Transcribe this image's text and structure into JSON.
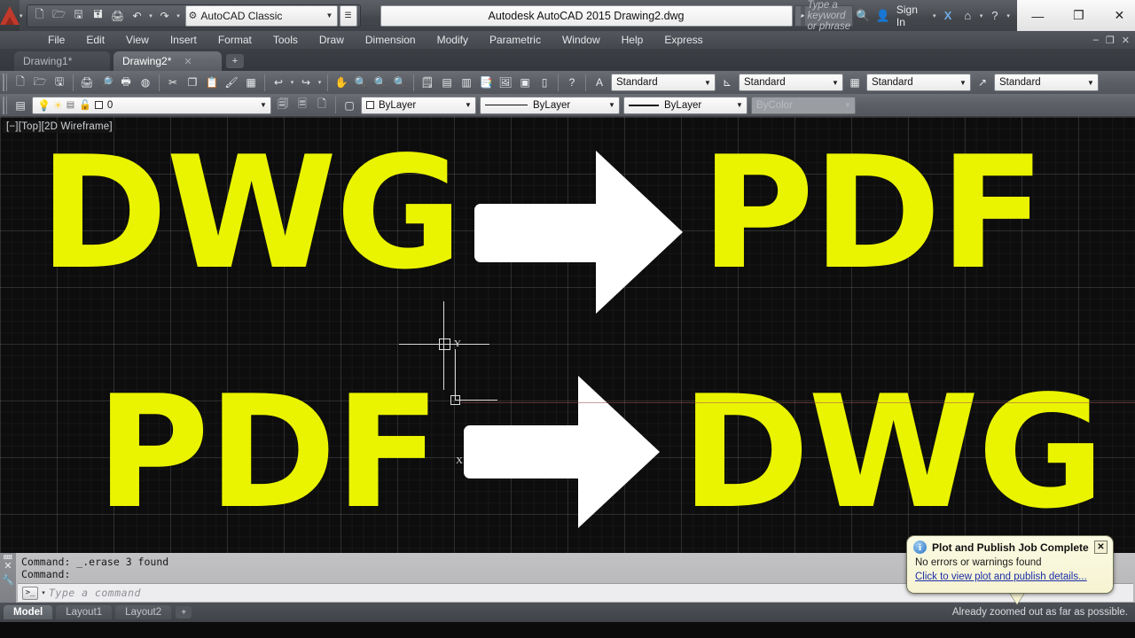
{
  "titlebar": {
    "app_logo_name": "autodesk-logo",
    "quick_access": [
      {
        "name": "new-file-icon",
        "glyph": "🗋"
      },
      {
        "name": "open-file-icon",
        "glyph": "🗁"
      },
      {
        "name": "save-icon",
        "glyph": "🖫"
      },
      {
        "name": "save-as-icon",
        "glyph": "🖫"
      },
      {
        "name": "plot-icon",
        "glyph": "🖨"
      },
      {
        "name": "undo-icon",
        "glyph": "↶"
      },
      {
        "name": "redo-icon",
        "glyph": "↷"
      }
    ],
    "workspace_value": "AutoCAD Classic",
    "document_title": "Autodesk AutoCAD 2015     Drawing2.dwg",
    "search_placeholder": "Type a keyword or phrase",
    "sign_in_label": "Sign In",
    "window_controls": {
      "minimize": "—",
      "maximize": "❐",
      "close": "✕"
    }
  },
  "menubar": {
    "items": [
      {
        "label": "File"
      },
      {
        "label": "Edit"
      },
      {
        "label": "View"
      },
      {
        "label": "Insert"
      },
      {
        "label": "Format"
      },
      {
        "label": "Tools"
      },
      {
        "label": "Draw"
      },
      {
        "label": "Dimension"
      },
      {
        "label": "Modify"
      },
      {
        "label": "Parametric"
      },
      {
        "label": "Window"
      },
      {
        "label": "Help"
      },
      {
        "label": "Express"
      }
    ],
    "doc_minimize": "–",
    "doc_restore": "❐",
    "doc_close": "✕"
  },
  "file_tabs": {
    "tabs": [
      {
        "label": "Drawing1*",
        "active": false
      },
      {
        "label": "Drawing2*",
        "active": true,
        "close": "✕"
      }
    ],
    "add_label": "+"
  },
  "toolbar_row1": {
    "styles": {
      "text_style": "Standard",
      "dim_style": "Standard",
      "table_style": "Standard",
      "mleader_style": "Standard"
    },
    "icons": [
      "new-icon",
      "open-icon",
      "save-icon",
      "plot-icon",
      "preview-icon",
      "publish-icon",
      "3dprint-icon",
      "cut-icon",
      "copy-icon",
      "paste-icon",
      "matchprop-icon",
      "blockeditor-icon",
      "undo-icon",
      "redo-icon",
      "pan-icon",
      "zoom-realtime-icon",
      "zoom-window-icon",
      "zoom-previous-icon",
      "properties-icon",
      "designcenter-icon",
      "toolpalettes-icon",
      "sheetset-icon",
      "xref-icon",
      "markup-icon",
      "help-icon",
      "textstyle-icon",
      "dimstyle-icon",
      "tablestyle-icon",
      "mleaderstyle-icon"
    ]
  },
  "toolbar_row2": {
    "layer_props_icon": "layer-properties-icon",
    "layer_value": "0",
    "layer_state_icons": [
      "bulb-icon",
      "sun-icon",
      "freeze-icon",
      "lock-icon",
      "color-swatch-icon"
    ],
    "layer_tool_icons": [
      "layer-previous-icon",
      "layer-isolate-icon",
      "layer-make-current-icon"
    ],
    "color_value": "ByLayer",
    "linetype_value": "ByLayer",
    "lineweight_value": "ByLayer",
    "plotstyle_value": "ByColor"
  },
  "canvas": {
    "viewport_label": "[−][Top][2D Wireframe]",
    "background_color": "#0d0d0d",
    "text_color": "#eaf400",
    "arrow_color": "#ffffff",
    "items": [
      {
        "name": "dwg-text-top",
        "text": "DWG"
      },
      {
        "name": "arrow-top",
        "text": "→"
      },
      {
        "name": "pdf-text-top",
        "text": "PDF"
      },
      {
        "name": "pdf-text-bottom",
        "text": "PDF"
      },
      {
        "name": "arrow-bottom",
        "text": "→"
      },
      {
        "name": "dwg-text-bottom",
        "text": "DWG"
      }
    ],
    "ucs_labels": {
      "x": "X",
      "y": "Y"
    }
  },
  "command_line": {
    "history_line1": "Command: _.erase 3 found",
    "history_line2": "Command:",
    "prompt_glyph": ">_",
    "input_placeholder": "Type a command",
    "input_value": ""
  },
  "status_bar": {
    "layout_tabs": [
      {
        "label": "Model",
        "active": true
      },
      {
        "label": "Layout1",
        "active": false
      },
      {
        "label": "Layout2",
        "active": false
      }
    ],
    "add_layout_label": "+",
    "status_message": "Already zoomed out as far as possible."
  },
  "balloon": {
    "title": "Plot and Publish Job Complete",
    "body": "No errors or warnings found",
    "link": "Click to view plot and publish details...",
    "close_label": "✕",
    "info_glyph": "i"
  }
}
